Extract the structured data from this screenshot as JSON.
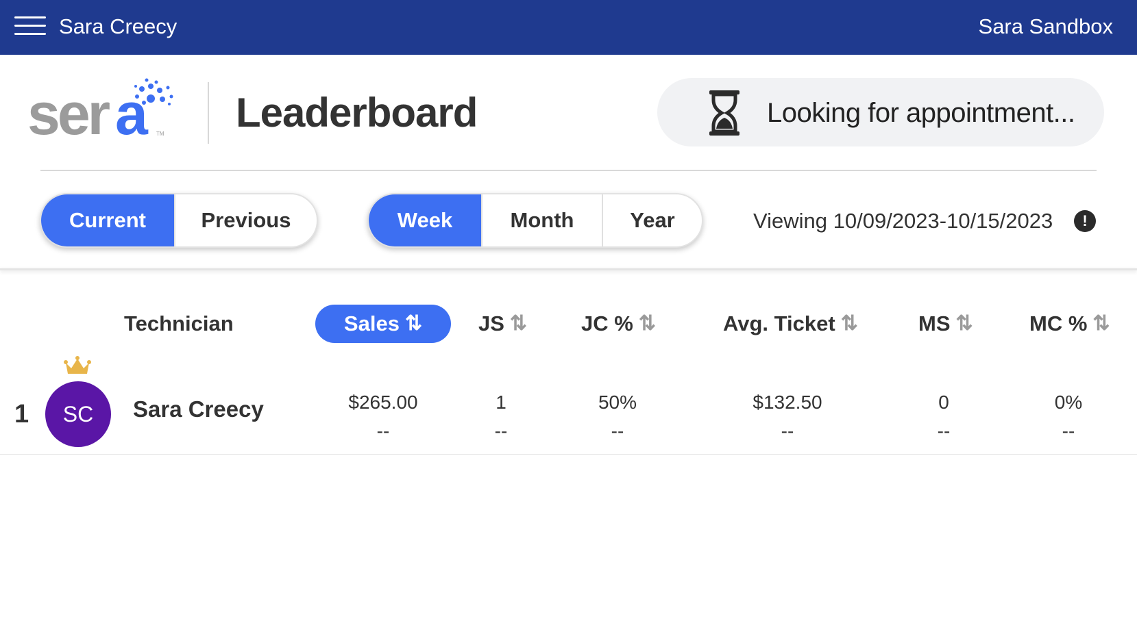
{
  "topbar": {
    "user_name": "Sara Creecy",
    "sandbox_label": "Sara Sandbox",
    "background": "#1f3a8f"
  },
  "header": {
    "logo_text": "sera",
    "logo_tm": "TM",
    "title": "Leaderboard",
    "appointment_status": "Looking for appointment..."
  },
  "filters": {
    "period": {
      "options": [
        "Current",
        "Previous"
      ],
      "selected": "Current"
    },
    "range": {
      "options": [
        "Week",
        "Month",
        "Year"
      ],
      "selected": "Week"
    },
    "viewing_label": "Viewing 10/09/2023-10/15/2023",
    "info_icon": "!"
  },
  "table": {
    "columns": {
      "technician": "Technician",
      "sales": "Sales",
      "js": "JS",
      "jc": "JC %",
      "avg_ticket": "Avg. Ticket",
      "ms": "MS",
      "mc": "MC %"
    },
    "sort_icon": "⇅",
    "sorted_by": "Sales",
    "rows": [
      {
        "rank": "1",
        "initials": "SC",
        "name": "Sara Creecy",
        "sales": "$265.00",
        "sales_sub": "--",
        "js": "1",
        "js_sub": "--",
        "jc": "50%",
        "jc_sub": "--",
        "avg_ticket": "$132.50",
        "avg_ticket_sub": "--",
        "ms": "0",
        "ms_sub": "--",
        "mc": "0%",
        "mc_sub": "--"
      }
    ]
  },
  "colors": {
    "accent": "#3d6ff2",
    "avatar": "#5a16a6",
    "crown": "#e8b54a",
    "logo_gray": "#9b9b9b",
    "logo_blue": "#3d6ff2"
  }
}
